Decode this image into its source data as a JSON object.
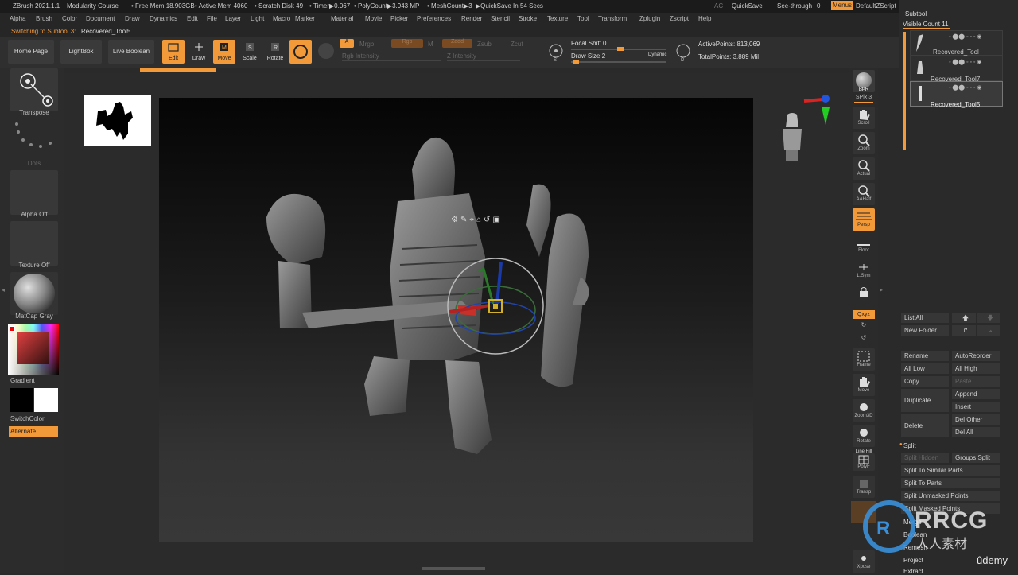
{
  "titlebar": {
    "app": "ZBrush 2021.1.1",
    "project": "Modularity Course",
    "free_mem": "• Free Mem 18.903GB",
    "active_mem": "• Active Mem 4060",
    "scratch": "• Scratch Disk 49",
    "timer": "• Timer▶0.067",
    "polycount": "• PolyCount▶3.943 MP",
    "meshcount": "• MeshCount▶3",
    "quicksave_in": "▶QuickSave In 54 Secs",
    "ac": "AC",
    "quicksave": "QuickSave",
    "see_through": "See-through",
    "see_through_val": "0",
    "menus": "Menus",
    "default_zscript": "DefaultZScript"
  },
  "menubar": [
    "Alpha",
    "Brush",
    "Color",
    "Document",
    "Draw",
    "Dynamics",
    "Edit",
    "File",
    "Layer",
    "Light",
    "Macro",
    "Marker",
    "Material",
    "Movie",
    "Picker",
    "Preferences",
    "Render",
    "Stencil",
    "Stroke",
    "Texture",
    "Tool",
    "Transform",
    "Zplugin",
    "Zscript",
    "Help"
  ],
  "status": {
    "switching": "Switching to Subtool 3:",
    "tool": "Recovered_Tool5"
  },
  "shelf": {
    "home_page": "Home Page",
    "lightbox": "LightBox",
    "live_boolean": "Live Boolean",
    "edit": "Edit",
    "draw": "Draw",
    "move": "Move",
    "scale": "Scale",
    "rotate": "Rotate",
    "a": "A",
    "mrgb": "Mrgb",
    "rgb": "Rgb",
    "m": "M",
    "zadd": "Zadd",
    "zsub": "Zsub",
    "zcut": "Zcut",
    "rgb_intensity": "Rgb Intensity",
    "z_intensity": "Z Intensity",
    "focal_shift": "Focal Shift",
    "focal_shift_val": "0",
    "draw_size": "Draw Size",
    "draw_size_val": "2",
    "dynamic": "Dynamic",
    "active_points": "ActivePoints: 813,069",
    "total_points": "TotalPoints: 3.889 Mil"
  },
  "left": {
    "transpose": "Transpose",
    "dots": "Dots",
    "alpha_off": "Alpha Off",
    "texture_off": "Texture Off",
    "matcap": "MatCap Gray",
    "gradient": "Gradient",
    "switchcolor": "SwitchColor",
    "alternate": "Alternate"
  },
  "rightbar": {
    "bpr": "BPR",
    "spix": "SPix 3",
    "scroll": "Scroll",
    "zoom": "Zoom",
    "actual": "Actual",
    "aahalf": "AAHalf",
    "persp": "Persp",
    "floor": "Floor",
    "lsym": "L.Sym",
    "xyz": "Qxyz",
    "frame": "Frame",
    "move": "Move",
    "zoom3d": "Zoom3D",
    "rotate": "Rotate",
    "linefill": "Line Fill",
    "polyf": "PolyF",
    "transp": "Transp",
    "xpose": "Xpose"
  },
  "subtool": {
    "header": "Subtool",
    "visible_count": "Visible Count 11",
    "items": [
      {
        "name": "Recovered_Tool"
      },
      {
        "name": "Recovered_Tool7"
      },
      {
        "name": "Recovered_Tool5"
      }
    ],
    "list_all": "List All",
    "new_folder": "New Folder",
    "rename": "Rename",
    "autoreorder": "AutoReorder",
    "all_low": "All Low",
    "all_high": "All High",
    "copy": "Copy",
    "paste": "Paste",
    "duplicate": "Duplicate",
    "append": "Append",
    "insert": "Insert",
    "delete": "Delete",
    "del_other": "Del Other",
    "del_all": "Del All",
    "split": "Split",
    "split_hidden": "Split Hidden",
    "groups_split": "Groups Split",
    "split_similar": "Split To Similar Parts",
    "split_parts": "Split To Parts",
    "split_unmasked": "Split Unmasked Points",
    "split_masked": "Split Masked Points",
    "merge": "Merge",
    "boolean": "Boolean",
    "remesh": "Remesh",
    "project": "Project",
    "extract": "Extract"
  },
  "watermark": {
    "brand": "RRCG",
    "sub": "人人素材",
    "udemy": "ûdemy"
  },
  "colors": {
    "accent": "#f29a3a",
    "panel": "#2c2c2c",
    "canvas_top": "#050505"
  }
}
